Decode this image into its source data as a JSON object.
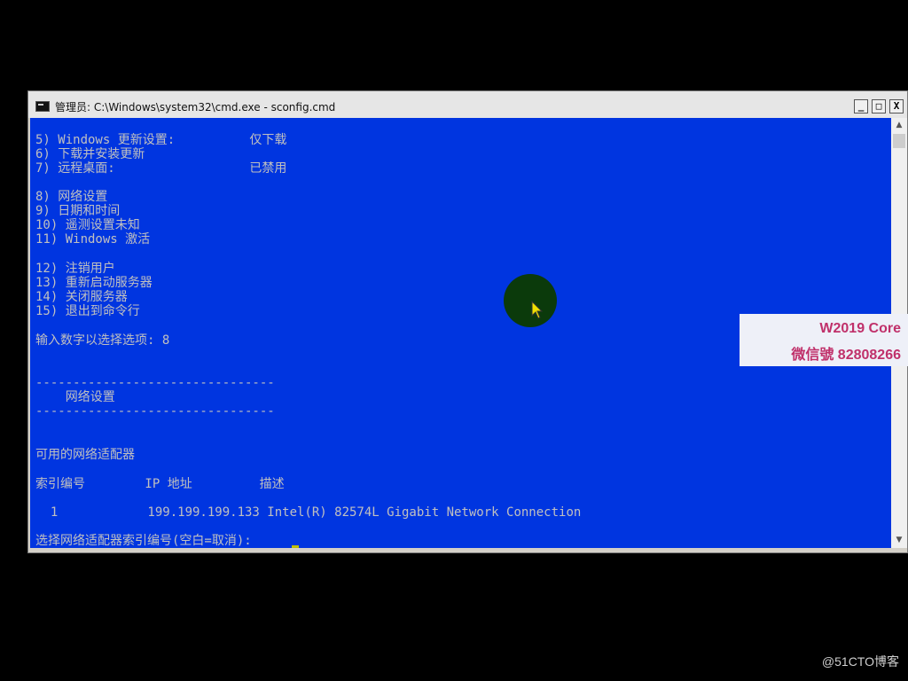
{
  "window": {
    "title": "管理员: C:\\Windows\\system32\\cmd.exe - sconfig.cmd",
    "minimize_label": "_",
    "maximize_label": "□",
    "close_label": "X"
  },
  "console": {
    "lines": [
      "5) Windows 更新设置:          仅下载",
      "6) 下载并安装更新",
      "7) 远程桌面:                  已禁用",
      "8) 网络设置",
      "9) 日期和时间",
      "10) 遥测设置未知",
      "11) Windows 激活",
      "12) 注销用户",
      "13) 重新启动服务器",
      "14) 关闭服务器",
      "15) 退出到命令行",
      "输入数字以选择选项: 8",
      "--------------------------------",
      "    网络设置",
      "--------------------------------",
      "可用的网络适配器",
      "索引编号        IP 地址         描述",
      "  1            199.199.199.133 Intel(R) 82574L Gigabit Network Connection",
      "选择网络适配器索引编号(空白=取消): "
    ]
  },
  "scrollbar": {
    "up_label": "▲",
    "down_label": "▼"
  },
  "overlay": {
    "line1": "W2019 Core",
    "line2": "微信號 82808266"
  },
  "watermark": "@51CTO博客",
  "colors": {
    "console_bg": "#0035e0",
    "console_text": "#c0c0c0",
    "overlay_text": "#c0306a"
  }
}
